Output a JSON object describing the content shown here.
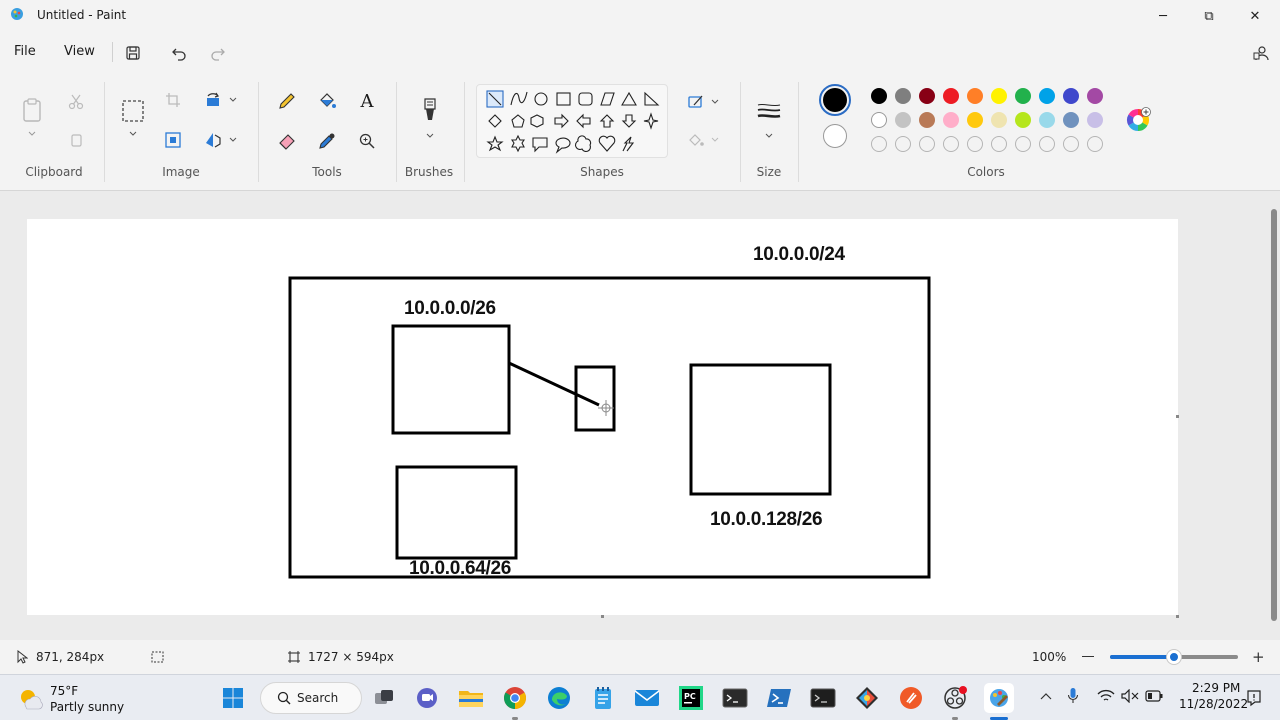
{
  "window": {
    "title": "Untitled - Paint",
    "minimize_glyph": "─",
    "maximize_glyph": "⧉",
    "close_glyph": "✕"
  },
  "menu": {
    "file": "File",
    "view": "View"
  },
  "ribbon": {
    "groups": {
      "clipboard": "Clipboard",
      "image": "Image",
      "tools": "Tools",
      "brushes": "Brushes",
      "shapes": "Shapes",
      "size": "Size",
      "colors": "Colors"
    },
    "text_tool_glyph": "A",
    "palette_row1": [
      "#000000",
      "#7f7f7f",
      "#880015",
      "#ed1c24",
      "#ff7f27",
      "#fff200",
      "#22b14c",
      "#00a2e8",
      "#3f48cc",
      "#a349a4"
    ],
    "palette_row2": [
      "#ffffff",
      "#c3c3c3",
      "#b97a57",
      "#ffaec9",
      "#ffc90e",
      "#efe4b0",
      "#b5e61d",
      "#99d9ea",
      "#7092be",
      "#c8bfe7"
    ],
    "primary_color": "#000000",
    "secondary_color": "#ffffff"
  },
  "canvas": {
    "labels": {
      "outer": "10.0.0.0/24",
      "subnet_a": "10.0.0.0/26",
      "subnet_b": "10.0.0.64/26",
      "subnet_c": "10.0.0.128/26"
    }
  },
  "status": {
    "cursor_position": "871, 284px",
    "canvas_size": "1727 × 594px",
    "zoom": "100%",
    "zoom_level": 0.5
  },
  "taskbar": {
    "weather_temp": "75°F",
    "weather_desc": "Partly sunny",
    "search_label": "Search",
    "pinned_icons": [
      "task-view",
      "teams-chat",
      "file-explorer",
      "chrome",
      "edge",
      "notepad",
      "mail",
      "pycharm",
      "terminal",
      "powershell",
      "command-prompt",
      "git-kraken",
      "brave",
      "obs",
      "paint"
    ],
    "time": "2:29 PM",
    "date": "11/28/2022"
  }
}
